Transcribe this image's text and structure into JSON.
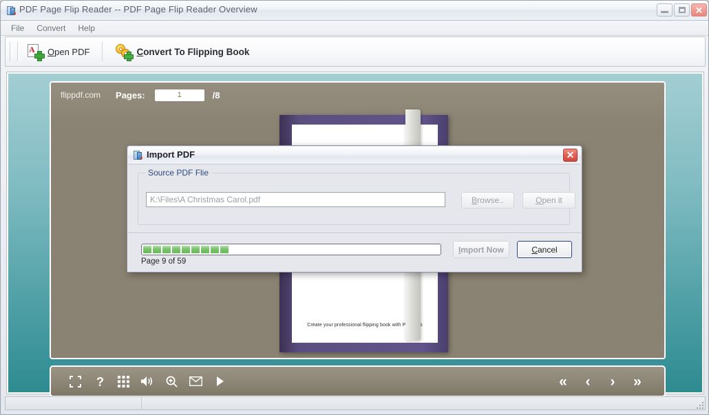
{
  "window": {
    "title": "PDF Page Flip Reader -- PDF Page Flip Reader Overview",
    "icon": "app-book-icon",
    "minimize_label": "Minimize",
    "maximize_label": "Maximize",
    "close_label": "Close"
  },
  "menubar": {
    "items": [
      {
        "label": "File"
      },
      {
        "label": "Convert"
      },
      {
        "label": "Help"
      }
    ]
  },
  "toolbar": {
    "buttons": [
      {
        "label_prefix": "",
        "accel": "O",
        "label_rest": "pen PDF",
        "icon": "pdf-add-icon",
        "bold": false
      },
      {
        "label_prefix": "",
        "accel": "C",
        "label_rest": "onvert To Flipping Book",
        "icon": "gears-add-icon",
        "bold": true
      }
    ]
  },
  "viewer": {
    "brand": "flippdf.com",
    "pages_label": "Pages:",
    "current_page": "1",
    "page_total": "/8",
    "book_caption": "Create your professional flipping book with PDF files",
    "toolbar_icons": [
      {
        "name": "fullscreen-icon"
      },
      {
        "name": "help-icon"
      },
      {
        "name": "thumbnails-icon"
      },
      {
        "name": "sound-icon"
      },
      {
        "name": "zoom-in-icon"
      },
      {
        "name": "email-icon"
      },
      {
        "name": "autoplay-icon"
      }
    ],
    "nav_icons": [
      {
        "name": "first-page-icon",
        "glyph": "«"
      },
      {
        "name": "previous-page-icon",
        "glyph": "‹"
      },
      {
        "name": "next-page-icon",
        "glyph": "›"
      },
      {
        "name": "last-page-icon",
        "glyph": "»"
      }
    ]
  },
  "dialog": {
    "title": "Import PDF",
    "close_label": "✕",
    "group_legend": "Source PDF Flie",
    "path_value": "K:\\Files\\A Christmas Carol.pdf",
    "path_placeholder": "K:\\Files\\A Christmas Carol.pdf",
    "browse": {
      "accel": "B",
      "rest": "rowse.."
    },
    "open_it": {
      "accel": "O",
      "rest": "pen it"
    },
    "import_now": {
      "accel": "I",
      "rest": "mport Now"
    },
    "cancel": {
      "accel": "C",
      "rest": "ancel"
    },
    "progress_text": "Page 9 of 59",
    "progress_chunks": 9,
    "progress_total_chunks": 34
  },
  "statusbar": {
    "cell_1": "",
    "cell_2": ""
  },
  "colors": {
    "viewer_gradient_top": "#a3ced3",
    "viewer_gradient_bottom": "#2d8b90",
    "stage_background": "#8a8272",
    "book_cover": "#5b4f80",
    "progress_green": "#79c36a",
    "close_red": "#e06055",
    "legend_blue": "#2c4a7c"
  }
}
